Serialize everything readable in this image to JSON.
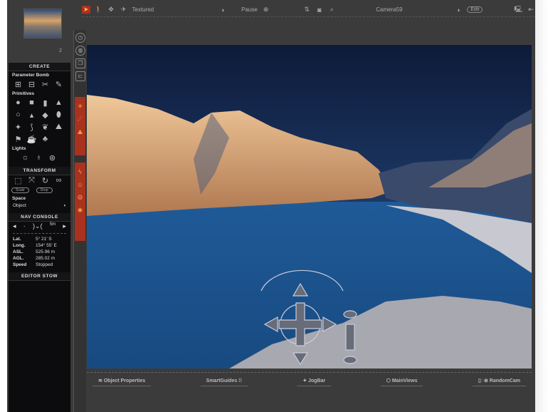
{
  "toolbar": {
    "render_mode": "Textured",
    "pause": "Pause",
    "camera": "Camera59",
    "edit": "Edit"
  },
  "thumbnail_number": "2",
  "sidebar": {
    "create": "CREATE",
    "parameter_bomb": "Parameter Bomb",
    "primitives": "Primitives",
    "lights": "Lights",
    "transform": "TRANSFORM",
    "transform_buttons": [
      "Scale",
      "Drop"
    ],
    "space": "Space",
    "space_value": "Object",
    "nav_console": "NAV CONSOLE",
    "nav_scale": "5m",
    "nav": [
      {
        "label": "Lat.",
        "value": "5° 21' S"
      },
      {
        "label": "Long.",
        "value": "154° 55' E"
      },
      {
        "label": "ASL.",
        "value": "525.96 m"
      },
      {
        "label": "AGL.",
        "value": "285.02 m"
      },
      {
        "label": "Speed",
        "value": "Stopped"
      }
    ],
    "editor_stow": "EDITOR STOW"
  },
  "bottombar": {
    "object_properties": "Object Properties",
    "smart_guides": "SmartGuides",
    "jog_bar": "JogBar",
    "main_views": "MainViews",
    "random_cam": "RandomCam"
  }
}
